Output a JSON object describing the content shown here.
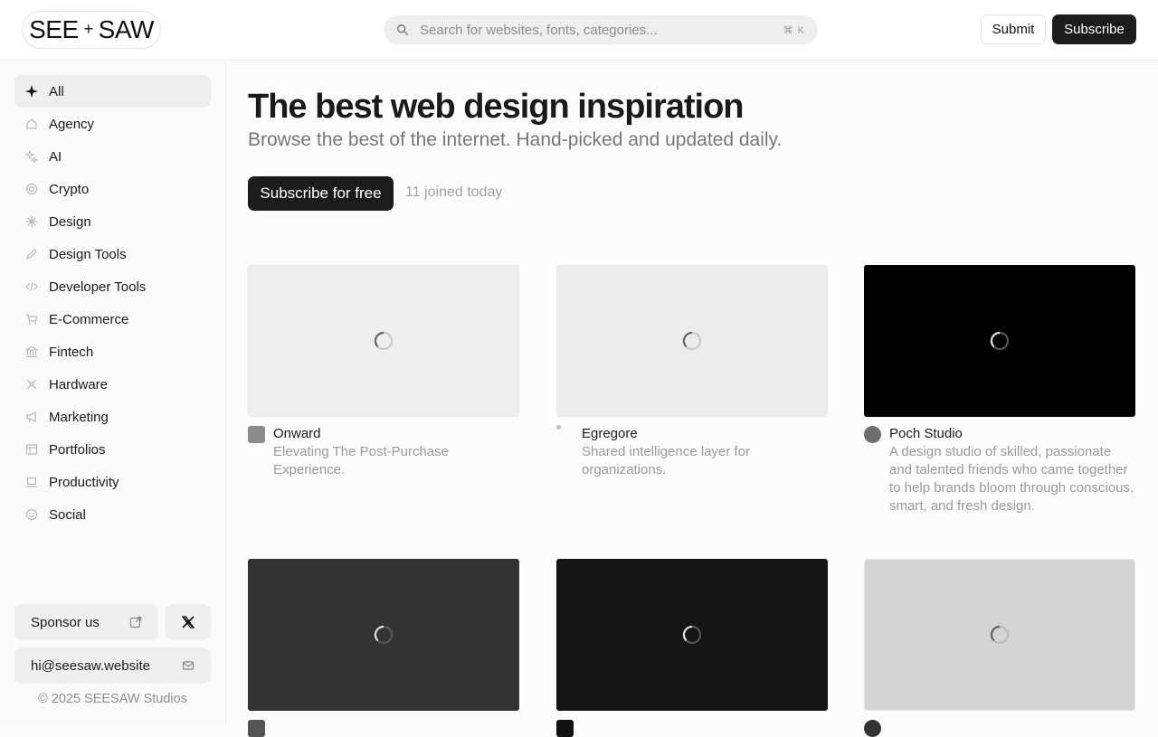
{
  "header": {
    "logo_left": "SEE",
    "logo_plus": "+",
    "logo_right": "SAW",
    "search_placeholder": "Search for websites, fonts, categories...",
    "search_shortcut": "⌘ K",
    "submit_label": "Submit",
    "subscribe_label": "Subscribe"
  },
  "sidebar": {
    "items": [
      {
        "label": "All",
        "icon": "sparkle-icon",
        "active": true
      },
      {
        "label": "Agency",
        "icon": "home-icon"
      },
      {
        "label": "AI",
        "icon": "ai-sparkles-icon"
      },
      {
        "label": "Crypto",
        "icon": "coin-icon"
      },
      {
        "label": "Design",
        "icon": "asterisk-icon"
      },
      {
        "label": "Design Tools",
        "icon": "pencil-icon"
      },
      {
        "label": "Developer Tools",
        "icon": "code-icon"
      },
      {
        "label": "E-Commerce",
        "icon": "cart-icon"
      },
      {
        "label": "Fintech",
        "icon": "bank-icon"
      },
      {
        "label": "Hardware",
        "icon": "hardware-icon"
      },
      {
        "label": "Marketing",
        "icon": "megaphone-icon"
      },
      {
        "label": "Portfolios",
        "icon": "layout-icon"
      },
      {
        "label": "Productivity",
        "icon": "laptop-icon"
      },
      {
        "label": "Social",
        "icon": "smile-icon"
      }
    ],
    "sponsor_label": "Sponsor us",
    "email_label": "hi@seesaw.website",
    "copyright": "© 2025 SEESAW Studios"
  },
  "hero": {
    "title": "The best web design inspiration",
    "subtitle": "Browse the best of the internet. Hand-picked and updated daily.",
    "cta_label": "Subscribe for free",
    "joined_text": "11 joined today"
  },
  "cards": [
    {
      "name": "Onward",
      "desc": "Elevating The Post-Purchase Experience.",
      "thumb_color": "#efefef",
      "favicon_color": "#8c8c8c"
    },
    {
      "name": "Egregore",
      "desc": "Shared intelligence layer for organizations.",
      "thumb_color": "#ececec",
      "favicon_color": "#bdbdbd"
    },
    {
      "name": "Poch Studio",
      "desc": "A design studio of skilled, passionate and talented friends who came together to help brands bloom through conscious, smart, and fresh design.",
      "thumb_color": "#000000",
      "favicon_color": "#6e6e6e"
    },
    {
      "name": "",
      "desc": "",
      "thumb_color": "#333333",
      "favicon_color": "#555555"
    },
    {
      "name": "",
      "desc": "",
      "thumb_color": "#151515",
      "favicon_color": "#111111"
    },
    {
      "name": "",
      "desc": "",
      "thumb_color": "#d4d4d4",
      "favicon_color": "#333333"
    }
  ]
}
